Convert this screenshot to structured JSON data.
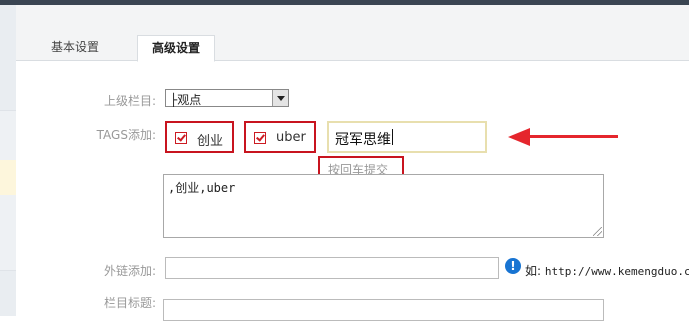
{
  "tabs": [
    {
      "label": "基本设置",
      "active": false
    },
    {
      "label": "高级设置",
      "active": true
    }
  ],
  "form": {
    "parent_column": {
      "label": "上级栏目:",
      "value": "├观点"
    },
    "tags": {
      "label": "TAGS添加:",
      "items": [
        {
          "label": "创业",
          "checked": true
        },
        {
          "label": "uber",
          "checked": true
        }
      ],
      "input_value": "冠军思维",
      "hint": "按回车提交"
    },
    "tags_text": ",创业,uber",
    "external_link": {
      "label": "外链添加:",
      "value": "",
      "hint_prefix": "如:",
      "hint_url": "http://www.kemengduo.com"
    },
    "column_title": {
      "label": "栏目标题:",
      "value": ""
    }
  },
  "colors": {
    "annotation_red": "#e5262d",
    "info_blue": "#1874d2"
  }
}
